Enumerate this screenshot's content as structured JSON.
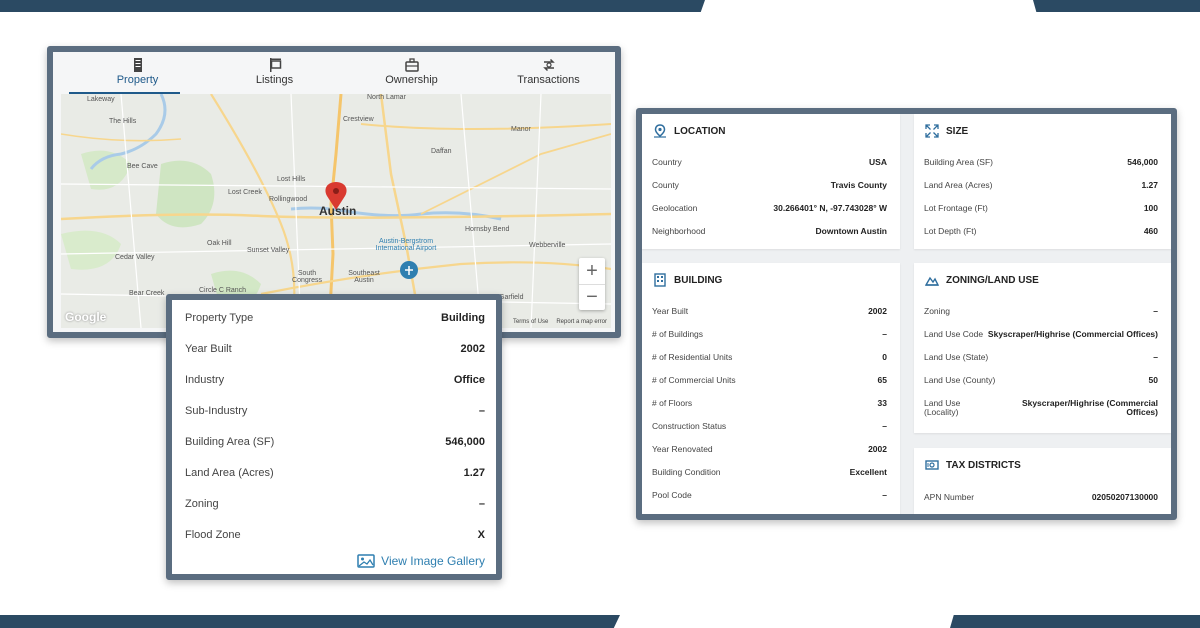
{
  "tabs": [
    {
      "label": "Property",
      "icon": "building-icon",
      "active": true
    },
    {
      "label": "Listings",
      "icon": "sign-icon",
      "active": false
    },
    {
      "label": "Ownership",
      "icon": "briefcase-icon",
      "active": false
    },
    {
      "label": "Transactions",
      "icon": "exchange-icon",
      "active": false
    }
  ],
  "map": {
    "city_label": "Austin",
    "labels": [
      "Lakeway",
      "The Hills",
      "Bee Cave",
      "Lost Creek",
      "Rollingwood",
      "Lost Hills",
      "Sunset Valley",
      "Cedar Valley",
      "Bear Creek",
      "Oak Hill",
      "Circle C Ranch",
      "North Lamar",
      "Crestview",
      "Manor",
      "Daffan",
      "Hornsby Bend",
      "Webberville",
      "Austin-Bergstrom International Airport",
      "South Congress",
      "Southeast Austin",
      "Garfield"
    ],
    "zoom_in": "+",
    "zoom_out": "−",
    "footer": [
      "Terms of Use",
      "Report a map error"
    ],
    "logo": "Google"
  },
  "details": [
    {
      "key": "Property Type",
      "value": "Building"
    },
    {
      "key": "Year Built",
      "value": "2002"
    },
    {
      "key": "Industry",
      "value": "Office"
    },
    {
      "key": "Sub-Industry",
      "value": "–"
    },
    {
      "key": "Building Area (SF)",
      "value": "546,000"
    },
    {
      "key": "Land Area (Acres)",
      "value": "1.27"
    },
    {
      "key": "Zoning",
      "value": "–"
    },
    {
      "key": "Flood Zone",
      "value": "X"
    }
  ],
  "gallery_link": "View Image Gallery",
  "location": {
    "title": "LOCATION",
    "rows": [
      {
        "key": "Country",
        "value": "USA"
      },
      {
        "key": "County",
        "value": "Travis County"
      },
      {
        "key": "Geolocation",
        "value": "30.266401° N, -97.743028° W"
      },
      {
        "key": "Neighborhood",
        "value": "Downtown Austin"
      }
    ]
  },
  "size": {
    "title": "SIZE",
    "rows": [
      {
        "key": "Building Area (SF)",
        "value": "546,000"
      },
      {
        "key": "Land Area (Acres)",
        "value": "1.27"
      },
      {
        "key": "Lot Frontage (Ft)",
        "value": "100"
      },
      {
        "key": "Lot Depth (Ft)",
        "value": "460"
      }
    ]
  },
  "building": {
    "title": "BUILDING",
    "rows": [
      {
        "key": "Year Built",
        "value": "2002"
      },
      {
        "key": "# of Buildings",
        "value": "–"
      },
      {
        "key": "# of Residential Units",
        "value": "0"
      },
      {
        "key": "# of Commercial Units",
        "value": "65"
      },
      {
        "key": "# of Floors",
        "value": "33"
      },
      {
        "key": "Construction Status",
        "value": "–"
      },
      {
        "key": "Year Renovated",
        "value": "2002"
      },
      {
        "key": "Building Condition",
        "value": "Excellent"
      },
      {
        "key": "Pool Code",
        "value": "–"
      }
    ]
  },
  "zoning": {
    "title": "ZONING/LAND USE",
    "rows": [
      {
        "key": "Zoning",
        "value": "–"
      },
      {
        "key": "Land Use Code",
        "value": "Skyscraper/Highrise (Commercial Offices)"
      },
      {
        "key": "Land Use (State)",
        "value": "–"
      },
      {
        "key": "Land Use (County)",
        "value": "50"
      },
      {
        "key": "Land Use (Locality)",
        "value": "Skyscraper/Highrise (Commercial Offices)"
      }
    ]
  },
  "tax": {
    "title": "TAX DISTRICTS",
    "rows": [
      {
        "key": "APN Number",
        "value": "02050207130000"
      }
    ]
  },
  "colors": {
    "accent": "#1f5a8a",
    "frame": "#5b6d80",
    "banner": "#2b4a63",
    "link": "#2f7fb0",
    "pin": "#d93a30"
  }
}
